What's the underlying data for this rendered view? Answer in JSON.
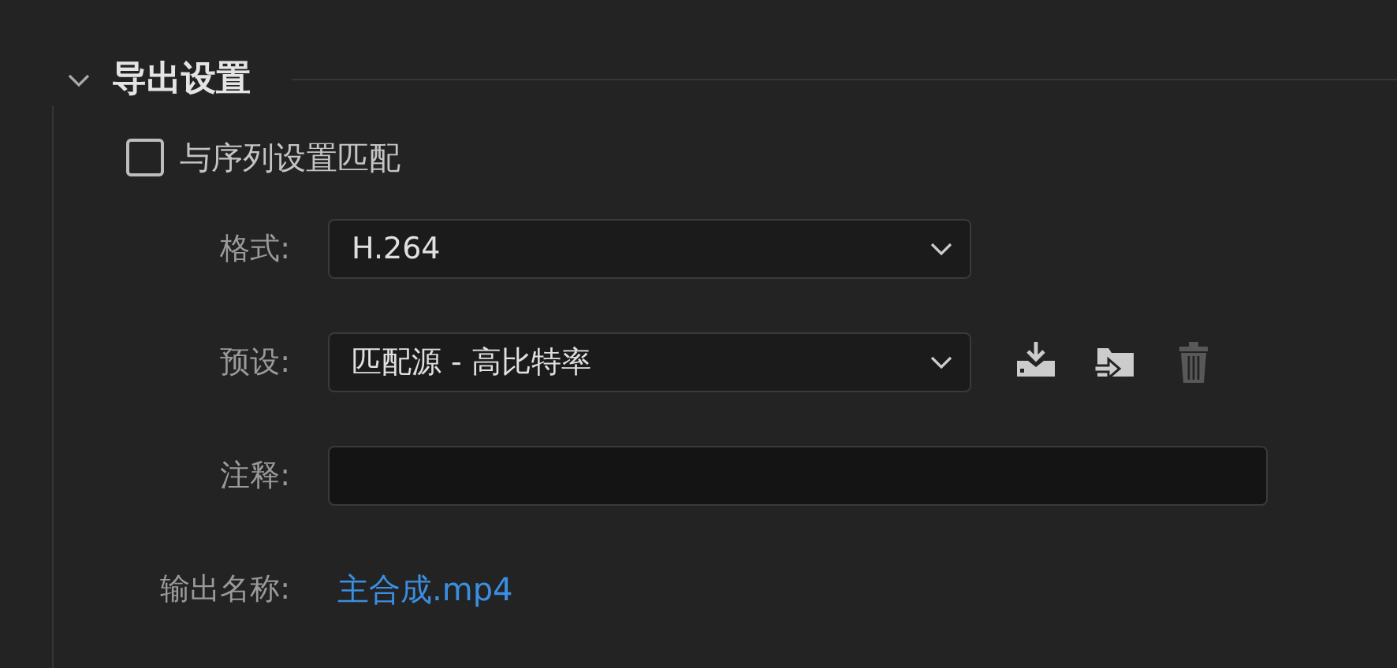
{
  "section": {
    "title": "导出设置",
    "expanded": true
  },
  "match_sequence": {
    "label": "与序列设置匹配",
    "checked": false
  },
  "format": {
    "label": "格式:",
    "value": "H.264"
  },
  "preset": {
    "label": "预设:",
    "value": "匹配源 - 高比特率"
  },
  "preset_actions": [
    {
      "kind": "import",
      "disabled": false
    },
    {
      "kind": "export",
      "disabled": false
    },
    {
      "kind": "delete",
      "disabled": true
    }
  ],
  "comment": {
    "label": "注释:"
  },
  "output_name": {
    "label": "输出名称:",
    "value": "主合成.mp4"
  }
}
